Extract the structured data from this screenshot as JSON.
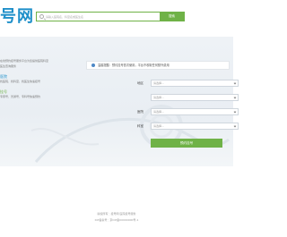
{
  "header": {
    "logo_text": "号网",
    "search_placeholder": "请输入医院名、科室名或医生名",
    "search_button": "搜索"
  },
  "left_panel": {
    "lines": [
      "在线预约挂号服务平台为您提供医院科室",
      "医生查询服务"
    ],
    "heading_1": "医院",
    "heading_1_lines": [
      "找医院、找科室、找医生快速挂号"
    ],
    "heading_2": "挂号",
    "heading_2_lines": [
      "专家号、普通号、专科号快速预约"
    ]
  },
  "notice": {
    "text": "温馨提醒：预约挂号首次使用，平台不收取任何额外费用"
  },
  "form": {
    "row_a_label": "地区",
    "row_a_value": "请选择...",
    "row_b_value": "请选择...",
    "row_c_label": "医院",
    "row_c_value": "请选择...",
    "row_d_label": "科室",
    "row_d_value": "请选择...",
    "submit_label": "预约挂号"
  },
  "footer": {
    "line_1": "版权所有：挂号网 医院挂号服务",
    "line_2": "ICP备案号：京ICP备00000000号-1"
  },
  "colors": {
    "brand_blue": "#1e8fc9",
    "brand_green": "#6fb247"
  }
}
